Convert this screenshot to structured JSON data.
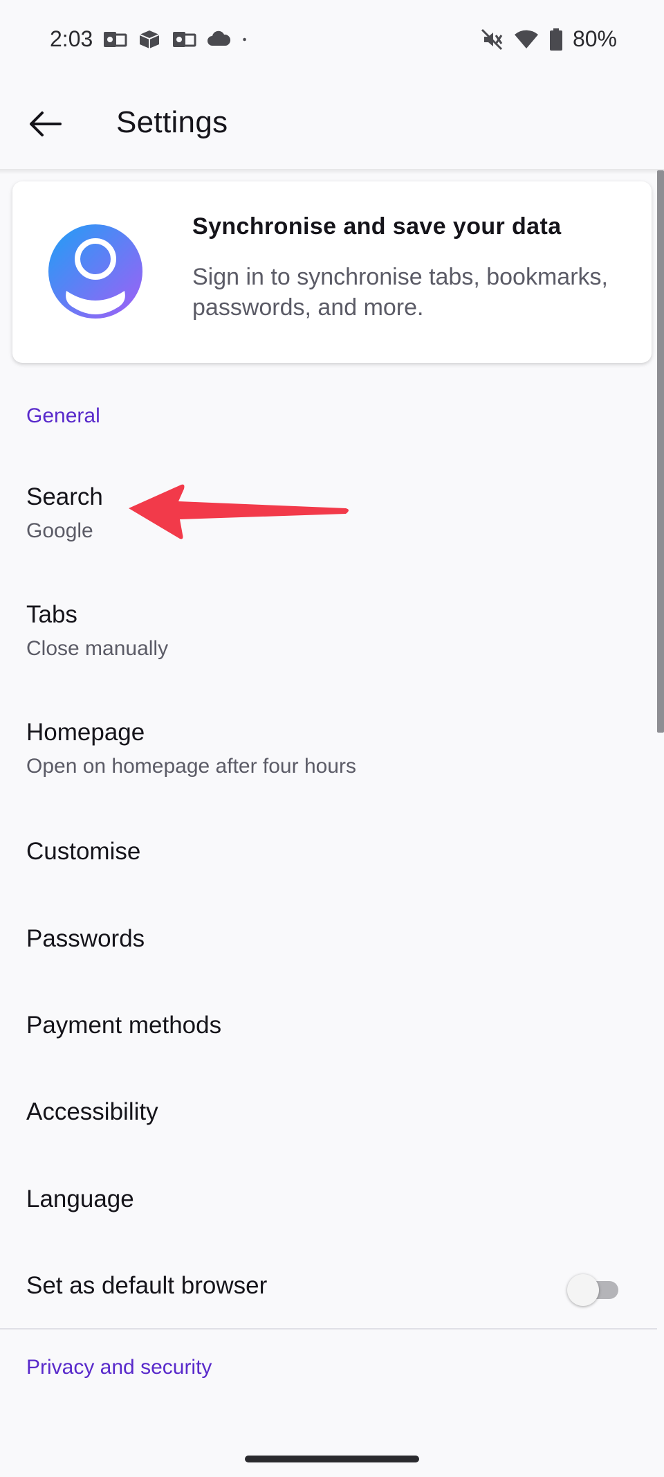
{
  "status_bar": {
    "time": "2:03",
    "left_icons": [
      "outlook-icon",
      "package-icon",
      "outlook-icon",
      "cloud-icon",
      "dot-icon"
    ],
    "right_icons": [
      "mute-icon",
      "wifi-icon",
      "battery-icon"
    ],
    "battery": "80%"
  },
  "app_bar": {
    "title": "Settings"
  },
  "signin_card": {
    "title": "Synchronise and save your data",
    "description": "Sign in to synchronise tabs, bookmarks, passwords, and more.",
    "avatar_gradient": [
      "#1f9ff5",
      "#a35ef5"
    ]
  },
  "sections": {
    "general": "General",
    "privacy": "Privacy and security"
  },
  "settings": [
    {
      "title": "Search",
      "summary": "Google"
    },
    {
      "title": "Tabs",
      "summary": "Close manually"
    },
    {
      "title": "Homepage",
      "summary": "Open on homepage after four hours"
    },
    {
      "title": "Customise"
    },
    {
      "title": "Passwords"
    },
    {
      "title": "Payment methods"
    },
    {
      "title": "Accessibility"
    },
    {
      "title": "Language"
    },
    {
      "title": "Set as default browser",
      "toggle": false
    }
  ],
  "colors": {
    "accent": "#592acb",
    "annotation": "#f23a4a"
  }
}
